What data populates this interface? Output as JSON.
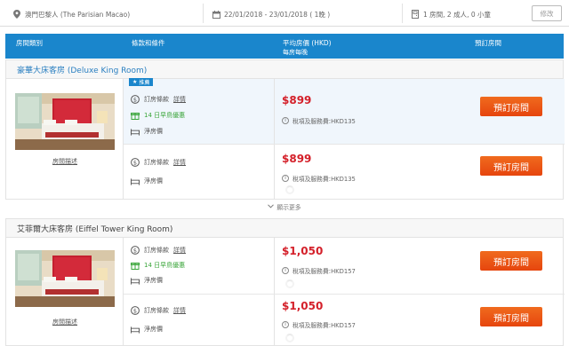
{
  "search": {
    "hotel": "澳門巴黎人 (The Parisian Macao)",
    "dates": "22/01/2018 - 23/01/2018 ( 1晚 )",
    "guests": "1 房間, 2 成人, 0 小童",
    "modify_label": "修改"
  },
  "table_header": {
    "room_type": "房間類別",
    "terms": "條款和條件",
    "avg_price": "平均房價 (HKD)",
    "avg_price_sub": "每房每晚",
    "book": "預訂房間"
  },
  "rooms": [
    {
      "name": "豪華大床客房 (Deluxe King Room)",
      "details_label": "房間描述",
      "rates": [
        {
          "badge": "推薦",
          "terms_label": "訂房條款",
          "details_link": "詳情",
          "breakfast": "14 日早鳥優惠",
          "rate_type": "淨房價",
          "price": "$899",
          "tax": "稅項及服務費:HKD135",
          "book_label": "預訂房間"
        },
        {
          "terms_label": "訂房條款",
          "details_link": "詳情",
          "rate_type": "淨房價",
          "price": "$899",
          "tax": "稅項及服務費:HKD135",
          "book_label": "預訂房間"
        }
      ],
      "show_more": "顯示更多"
    },
    {
      "name": "艾菲爾大床客房 (Eiffel Tower King Room)",
      "details_label": "房間描述",
      "rates": [
        {
          "terms_label": "訂房條款",
          "details_link": "詳情",
          "breakfast": "14 日早鳥優惠",
          "rate_type": "淨房價",
          "price": "$1,050",
          "tax": "稅項及服務費:HKD157",
          "book_label": "預訂房間"
        },
        {
          "terms_label": "訂房條款",
          "details_link": "詳情",
          "rate_type": "淨房價",
          "price": "$1,050",
          "tax": "稅項及服務費:HKD157",
          "book_label": "預訂房間"
        }
      ]
    }
  ],
  "icons": {
    "location": "location-pin-icon",
    "calendar": "calendar-icon",
    "guests": "door-icon",
    "terms": "dollar-circle-icon",
    "breakfast": "gift-icon",
    "rate": "bed-icon",
    "info": "info-icon",
    "chevron": "chevron-down-icon"
  },
  "colors": {
    "header_blue": "#1a86cc",
    "price_red": "#d4202a",
    "book_orange": "#e6450e",
    "offer_green": "#3aa53a"
  }
}
